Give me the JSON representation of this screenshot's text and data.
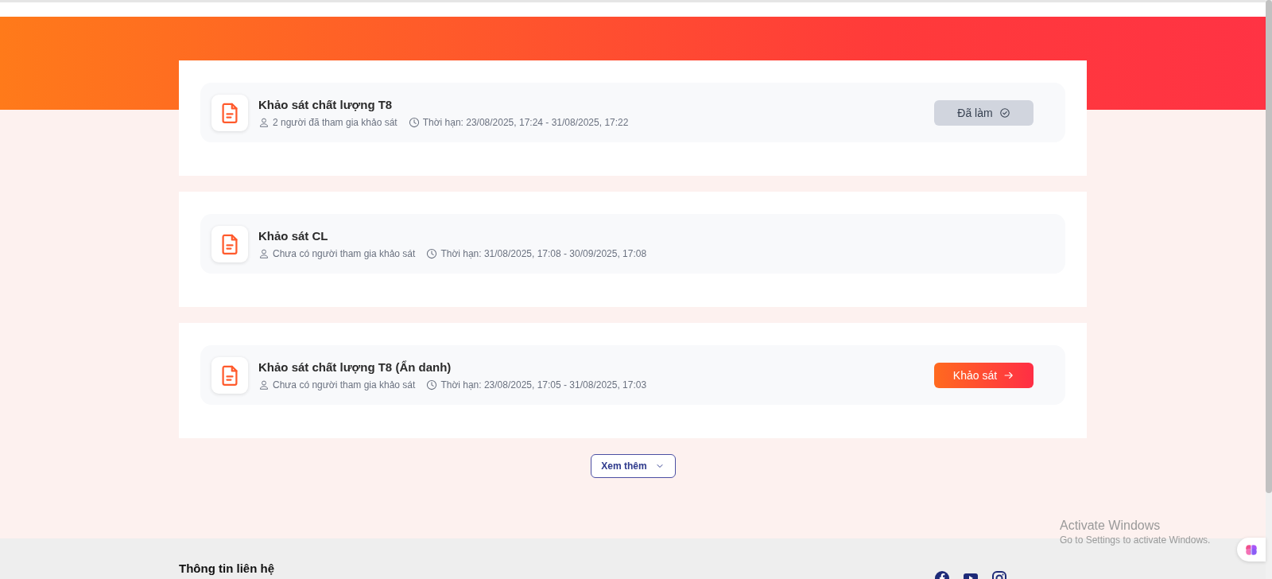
{
  "surveys": [
    {
      "title": "Khảo sát chất lượng T8",
      "participants": "2 người đã tham gia khảo sát",
      "deadline": "Thời hạn: 23/08/2025, 17:24 - 31/08/2025, 17:22",
      "action": {
        "label": "Đã làm",
        "kind": "done"
      }
    },
    {
      "title": "Khảo sát CL",
      "participants": "Chưa có người tham gia khảo sát",
      "deadline": "Thời hạn: 31/08/2025, 17:08 - 30/09/2025, 17:08"
    },
    {
      "title": "Khảo sát chất lượng T8 (Ẩn danh)",
      "participants": "Chưa có người tham gia khảo sát",
      "deadline": "Thời hạn: 23/08/2025, 17:05 - 31/08/2025, 17:03",
      "action": {
        "label": "Khảo sát",
        "kind": "start"
      }
    }
  ],
  "more_button": "Xem thêm",
  "footer": {
    "heading": "Thông tin liên hệ"
  },
  "os_notice": {
    "title": "Activate Windows",
    "subtitle": "Go to Settings to activate Windows."
  }
}
